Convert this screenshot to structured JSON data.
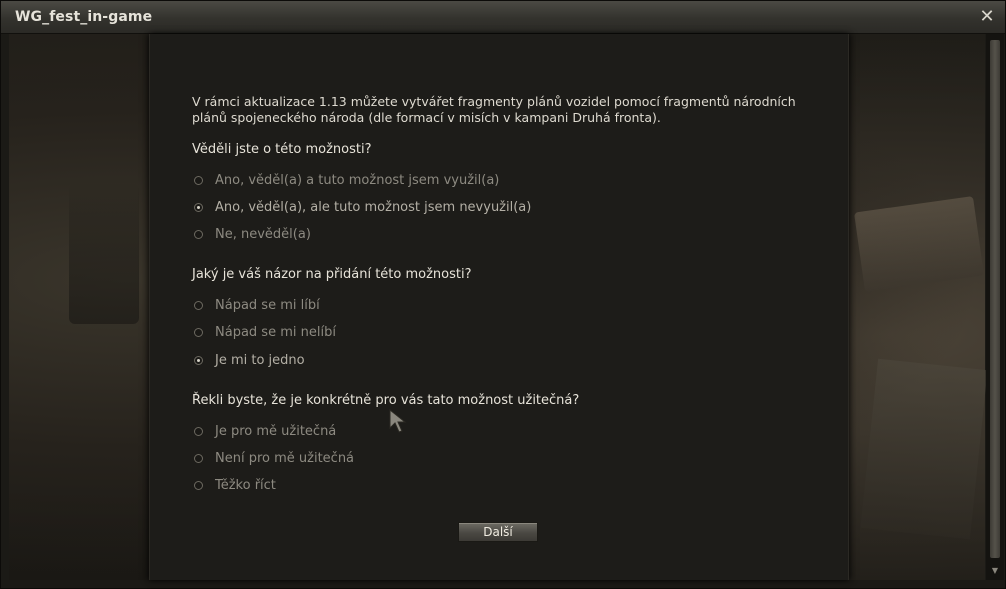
{
  "window": {
    "title": "WG_fest_in-game",
    "close_icon": "close-icon"
  },
  "survey": {
    "intro": "V rámci aktualizace 1.13 můžete vytvářet fragmenty plánů vozidel pomocí fragmentů národních plánů spojeneckého národa (dle formací v misích v kampani Druhá fronta).",
    "questions": [
      {
        "text": "Věděli jste o této možnosti?",
        "options": [
          {
            "label": "Ano, věděl(a) a tuto možnost jsem využil(a)",
            "checked": false
          },
          {
            "label": "Ano, věděl(a), ale tuto možnost jsem nevyužil(a)",
            "checked": true
          },
          {
            "label": "Ne, nevěděl(a)",
            "checked": false
          }
        ]
      },
      {
        "text": "Jaký je váš názor na přidání této možnosti?",
        "options": [
          {
            "label": "Nápad se mi líbí",
            "checked": false
          },
          {
            "label": "Nápad se mi nelíbí",
            "checked": false
          },
          {
            "label": "Je mi to jedno",
            "checked": true
          }
        ]
      },
      {
        "text": "Řekli byste, že je konkrétně pro vás tato možnost užitečná?",
        "options": [
          {
            "label": "Je pro mě užitečná",
            "checked": false
          },
          {
            "label": "Není pro mě užitečná",
            "checked": false
          },
          {
            "label": "Těžko říct",
            "checked": false
          }
        ]
      }
    ],
    "next_label": "Další"
  },
  "colors": {
    "background": "#1d1c19",
    "text": "#dedad0",
    "muted": "#8d8a81"
  }
}
